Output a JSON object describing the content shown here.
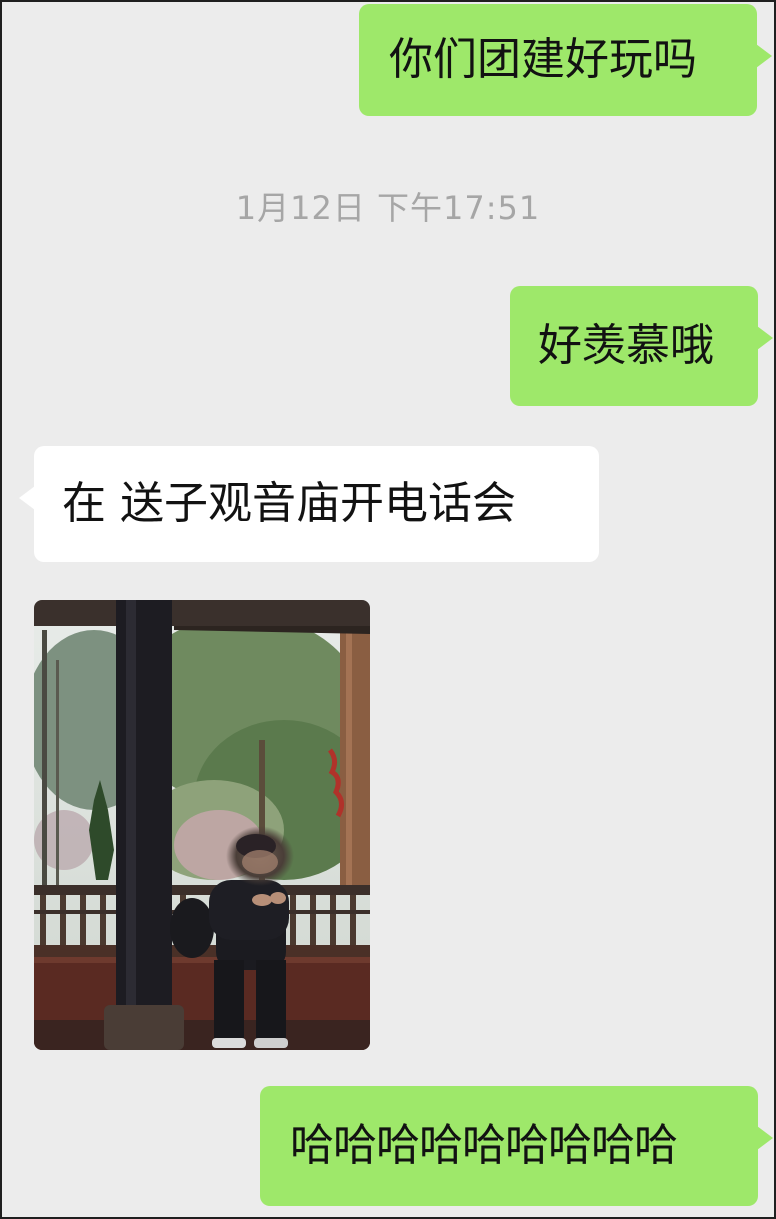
{
  "chat": {
    "messages": [
      {
        "sender": "me",
        "text": "你们团建好玩吗"
      },
      {
        "timestamp": "1月12日 下午17:51"
      },
      {
        "sender": "me",
        "text": "好羡慕哦"
      },
      {
        "sender": "other",
        "text": "在 送子观音庙开电话会"
      },
      {
        "sender": "other",
        "type": "image"
      },
      {
        "sender": "me",
        "text": "哈哈哈哈哈哈哈哈哈"
      }
    ]
  },
  "colors": {
    "background": "#ececec",
    "outgoing_bubble": "#9ee86a",
    "incoming_bubble": "#ffffff",
    "timestamp_text": "#a6a6a6"
  }
}
